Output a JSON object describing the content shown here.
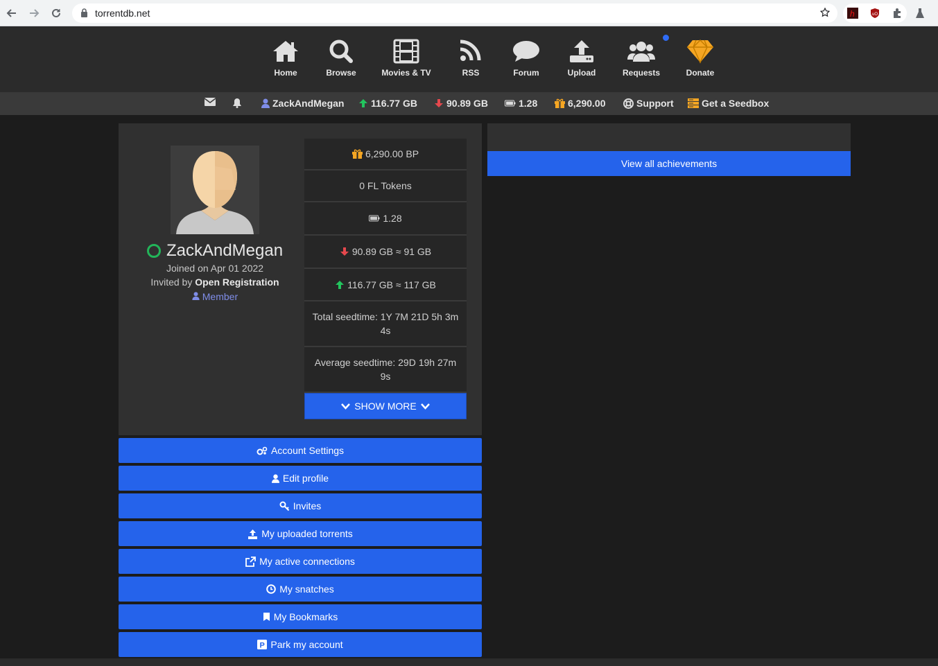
{
  "browser": {
    "url": "torrentdb.net"
  },
  "nav": {
    "items": [
      {
        "label": "Home",
        "icon": "home-icon"
      },
      {
        "label": "Browse",
        "icon": "search-icon"
      },
      {
        "label": "Movies & TV",
        "icon": "film-icon"
      },
      {
        "label": "RSS",
        "icon": "rss-icon"
      },
      {
        "label": "Forum",
        "icon": "chat-icon"
      },
      {
        "label": "Upload",
        "icon": "upload-icon"
      },
      {
        "label": "Requests",
        "icon": "users-icon"
      },
      {
        "label": "Donate",
        "icon": "diamond-icon"
      }
    ]
  },
  "statbar": {
    "username": "ZackAndMegan",
    "upload": "116.77 GB",
    "download": "90.89 GB",
    "ratio": "1.28",
    "bonus": "6,290.00",
    "support": "Support",
    "seedbox": "Get a Seedbox"
  },
  "profile": {
    "username": "ZackAndMegan",
    "joined": "Joined on Apr 01 2022",
    "invited_prefix": "Invited by",
    "invited_by": "Open Registration",
    "group": "Member",
    "stats": [
      "6,290.00 BP",
      "0 FL Tokens",
      "1.28",
      "90.89 GB ≈ 91 GB",
      "116.77 GB ≈ 117 GB",
      "Total seedtime: 1Y 7M 21D 5h 3m 4s",
      "Average seedtime: 29D 19h 27m 9s"
    ],
    "show_more": "SHOW MORE"
  },
  "actions": [
    "Account Settings",
    "Edit profile",
    "Invites",
    "My uploaded torrents",
    "My active connections",
    "My snatches",
    "My Bookmarks",
    "Park my account"
  ],
  "achievements": {
    "button": "View all achievements"
  },
  "colors": {
    "accent": "#2563eb",
    "up": "#22c55e",
    "down": "#e5484d",
    "gold": "#f5a623",
    "online": "#22b559"
  }
}
